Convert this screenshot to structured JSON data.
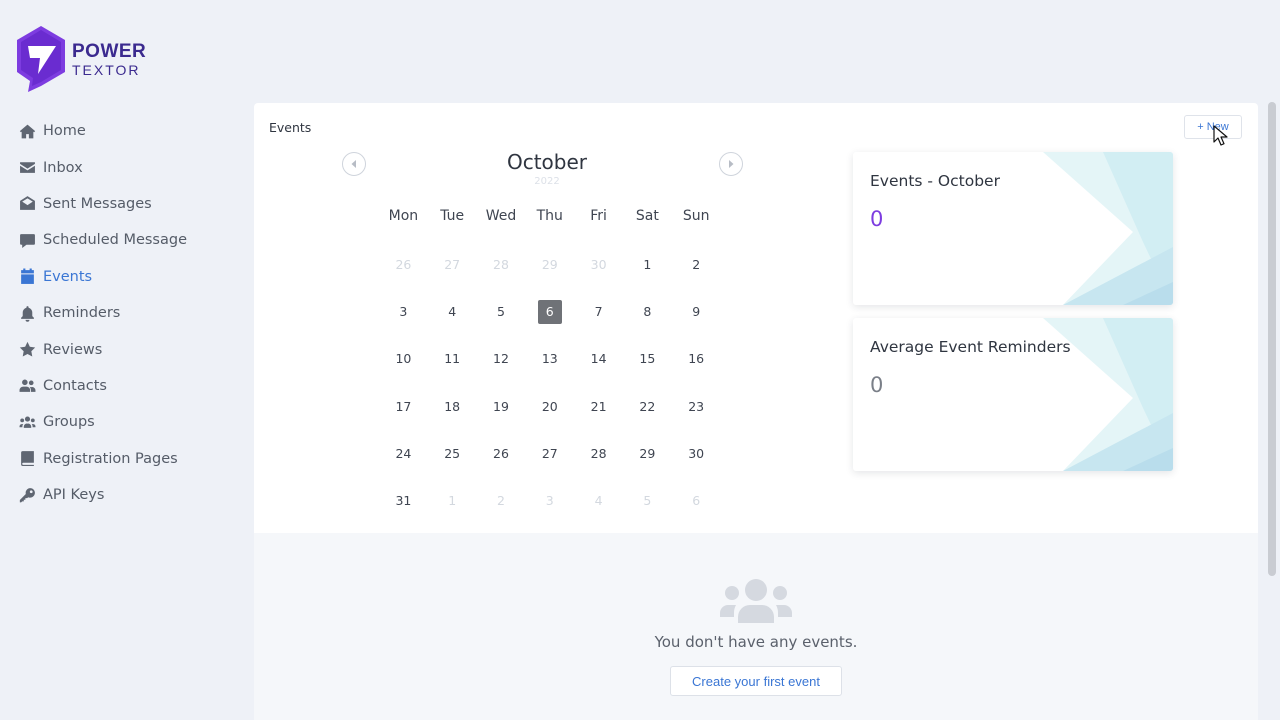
{
  "brand": {
    "line1": "POWER",
    "line2": "TEXTOR",
    "color": "#7d3ce0"
  },
  "sidebar": {
    "items": [
      {
        "label": "Home",
        "icon": "home-icon"
      },
      {
        "label": "Inbox",
        "icon": "envelope-icon"
      },
      {
        "label": "Sent Messages",
        "icon": "envelope-open-icon"
      },
      {
        "label": "Scheduled Message",
        "icon": "comment-icon"
      },
      {
        "label": "Events",
        "icon": "calendar-icon",
        "active": true
      },
      {
        "label": "Reminders",
        "icon": "bell-icon"
      },
      {
        "label": "Reviews",
        "icon": "star-icon"
      },
      {
        "label": "Contacts",
        "icon": "user-friends-icon"
      },
      {
        "label": "Groups",
        "icon": "users-icon"
      },
      {
        "label": "Registration Pages",
        "icon": "book-icon"
      },
      {
        "label": "API Keys",
        "icon": "key-icon"
      }
    ],
    "active_color": "#3a76d4"
  },
  "panel": {
    "title": "Events",
    "new_label": "+ New"
  },
  "calendar": {
    "month": "October",
    "year": "2022",
    "weekdays": [
      "Mon",
      "Tue",
      "Wed",
      "Thu",
      "Fri",
      "Sat",
      "Sun"
    ],
    "weeks": [
      [
        {
          "d": "26",
          "m": true
        },
        {
          "d": "27",
          "m": true
        },
        {
          "d": "28",
          "m": true
        },
        {
          "d": "29",
          "m": true
        },
        {
          "d": "30",
          "m": true
        },
        {
          "d": "1"
        },
        {
          "d": "2"
        }
      ],
      [
        {
          "d": "3"
        },
        {
          "d": "4"
        },
        {
          "d": "5"
        },
        {
          "d": "6",
          "today": true
        },
        {
          "d": "7"
        },
        {
          "d": "8"
        },
        {
          "d": "9"
        }
      ],
      [
        {
          "d": "10"
        },
        {
          "d": "11"
        },
        {
          "d": "12"
        },
        {
          "d": "13"
        },
        {
          "d": "14"
        },
        {
          "d": "15"
        },
        {
          "d": "16"
        }
      ],
      [
        {
          "d": "17"
        },
        {
          "d": "18"
        },
        {
          "d": "19"
        },
        {
          "d": "20"
        },
        {
          "d": "21"
        },
        {
          "d": "22"
        },
        {
          "d": "23"
        }
      ],
      [
        {
          "d": "24"
        },
        {
          "d": "25"
        },
        {
          "d": "26"
        },
        {
          "d": "27"
        },
        {
          "d": "28"
        },
        {
          "d": "29"
        },
        {
          "d": "30"
        }
      ],
      [
        {
          "d": "31"
        },
        {
          "d": "1",
          "m": true
        },
        {
          "d": "2",
          "m": true
        },
        {
          "d": "3",
          "m": true
        },
        {
          "d": "4",
          "m": true
        },
        {
          "d": "5",
          "m": true
        },
        {
          "d": "6",
          "m": true
        }
      ]
    ]
  },
  "stats": {
    "events_title": "Events - October",
    "events_value": "0",
    "reminders_title": "Average Event Reminders",
    "reminders_value": "0"
  },
  "empty_state": {
    "message": "You don't have any events.",
    "button_label": "Create your first event"
  }
}
